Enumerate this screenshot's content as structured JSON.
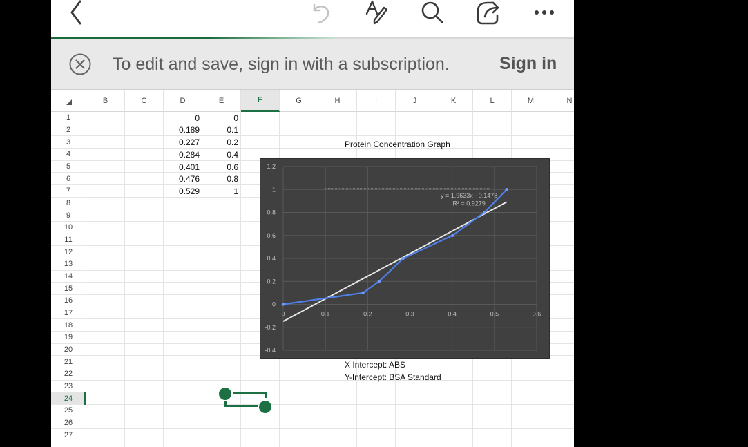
{
  "toolbar": {
    "icons": [
      "back-chevron-icon",
      "undo-icon",
      "draw-pen-icon",
      "search-icon",
      "share-icon",
      "more-icon"
    ],
    "colors": {
      "icon": "#3a3a3a",
      "disabled": "#c2c2c2",
      "progress": "#1a6b3c"
    }
  },
  "loading_progress": 0.55,
  "banner": {
    "message": "To edit and save, sign in with a subscription.",
    "sign_in_label": "Sign in"
  },
  "sheet": {
    "corner_icon": "select-all-triangle-icon",
    "columns": [
      "B",
      "C",
      "D",
      "E",
      "F",
      "G",
      "H",
      "I",
      "J",
      "K",
      "L",
      "M",
      "N"
    ],
    "selected_column": "F",
    "rows": [
      "1",
      "2",
      "3",
      "4",
      "5",
      "6",
      "7",
      "8",
      "9",
      "10",
      "11",
      "12",
      "13",
      "14",
      "15",
      "16",
      "17",
      "18",
      "19",
      "20",
      "21",
      "22",
      "23",
      "24",
      "25",
      "26",
      "27"
    ],
    "selected_row": "24",
    "col_d": [
      "0",
      "0.189",
      "0.227",
      "0.284",
      "0.401",
      "0.476",
      "0.529"
    ],
    "col_e": [
      "0",
      "0.1",
      "0.2",
      "0.4",
      "0.6",
      "0.8",
      "1"
    ],
    "text_cells": {
      "i3": "Protein Concentration Graph",
      "i21": "X Intercept: ABS",
      "i22": "Y-Intercept: BSA Standard"
    }
  },
  "chart_data": {
    "type": "scatter",
    "title": "",
    "xlabel": "",
    "ylabel": "",
    "xlim": [
      0,
      0.6
    ],
    "ylim": [
      -0.4,
      1.2
    ],
    "x_ticks": [
      "0",
      "0.1",
      "0.2",
      "0.3",
      "0.4",
      "0.5",
      "0.6"
    ],
    "y_ticks": [
      "-0.4",
      "-0.2",
      "0",
      "0.2",
      "0.4",
      "0.6",
      "0.8",
      "1",
      "1.2"
    ],
    "series": [
      {
        "x": [
          0,
          0.189,
          0.227,
          0.284,
          0.401,
          0.476,
          0.529
        ],
        "y": [
          0,
          0.1,
          0.2,
          0.4,
          0.6,
          0.8,
          1
        ]
      }
    ],
    "trendline": {
      "slope": 1.9633,
      "intercept": -0.1478
    },
    "trendline_equation": "y = 1.9633x - 0.1478",
    "r_squared": "R² = 0.9279",
    "colors": {
      "background": "#404040",
      "series": "#4f7fe8",
      "trendline": "#e6e6e6",
      "grid": "#595959"
    }
  }
}
